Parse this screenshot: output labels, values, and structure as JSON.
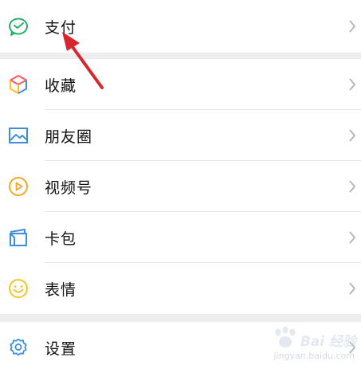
{
  "menu": {
    "group1": [
      {
        "label": "支付",
        "icon": "wechat-pay-icon"
      }
    ],
    "group2": [
      {
        "label": "收藏",
        "icon": "favorites-cube-icon"
      },
      {
        "label": "朋友圈",
        "icon": "moments-image-icon"
      },
      {
        "label": "视频号",
        "icon": "channels-play-icon"
      },
      {
        "label": "卡包",
        "icon": "card-wallet-icon"
      },
      {
        "label": "表情",
        "icon": "emoji-smile-icon"
      }
    ],
    "group3": [
      {
        "label": "设置",
        "icon": "settings-gear-icon"
      }
    ]
  },
  "annotation": {
    "arrow_color": "#d9262c"
  },
  "watermark": {
    "text": "Bai  经验",
    "sub": "jingyan.baidu.com"
  },
  "colors": {
    "pay_green": "#2aae67",
    "fav_red": "#ff5a5f",
    "fav_yellow": "#ffbf2a",
    "fav_blue": "#3f8ee8",
    "moments_blue": "#3e8ee0",
    "channels_orange": "#f5a623",
    "card_blue": "#3e8ee0",
    "emoji_yellow": "#f7c325",
    "settings_blue": "#3e8ee0",
    "chevron": "#b2b2b2"
  }
}
